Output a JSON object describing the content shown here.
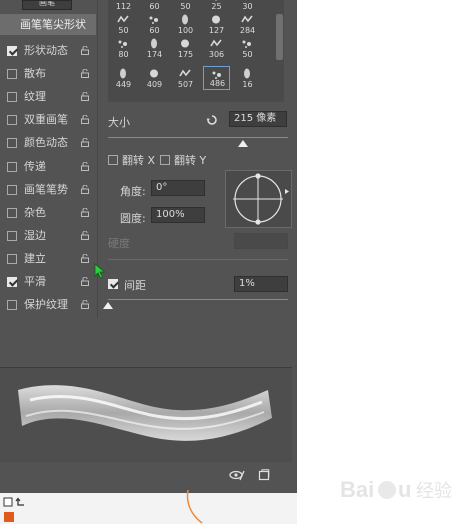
{
  "top": {
    "tab_label": "画笔"
  },
  "section_label": "画笔笔尖形状",
  "options": [
    {
      "label": "形状动态",
      "checked": true
    },
    {
      "label": "散布",
      "checked": false
    },
    {
      "label": "纹理",
      "checked": false
    },
    {
      "label": "双重画笔",
      "checked": false
    },
    {
      "label": "颜色动态",
      "checked": false
    },
    {
      "label": "传递",
      "checked": false
    },
    {
      "label": "画笔笔势",
      "checked": false
    },
    {
      "label": "杂色",
      "checked": false
    },
    {
      "label": "湿边",
      "checked": false
    },
    {
      "label": "建立",
      "checked": false
    },
    {
      "label": "平滑",
      "checked": true
    },
    {
      "label": "保护纹理",
      "checked": false
    }
  ],
  "brush_presets": [
    [
      "112",
      "60",
      "50",
      "25",
      "30"
    ],
    [
      "50",
      "60",
      "100",
      "127",
      "284"
    ],
    [
      "80",
      "174",
      "175",
      "306",
      "50"
    ],
    [
      "449",
      "409",
      "507",
      "486",
      "16"
    ]
  ],
  "selected_preset": "486",
  "size": {
    "label": "大小",
    "value": "215 像素"
  },
  "flip": {
    "label_x": "翻转",
    "axis_x": "X",
    "label_y": "翻转",
    "axis_y": "Y"
  },
  "angle": {
    "label": "角度:",
    "value": "0°"
  },
  "roundness": {
    "label": "圆度:",
    "value": "100%"
  },
  "hardness": {
    "label": "硬度"
  },
  "spacing": {
    "label": "间距",
    "value": "1%",
    "checked": true
  },
  "colors": {
    "panel": "#535353",
    "accent": "#6f9fd0",
    "cursor": "#2ecc40"
  }
}
